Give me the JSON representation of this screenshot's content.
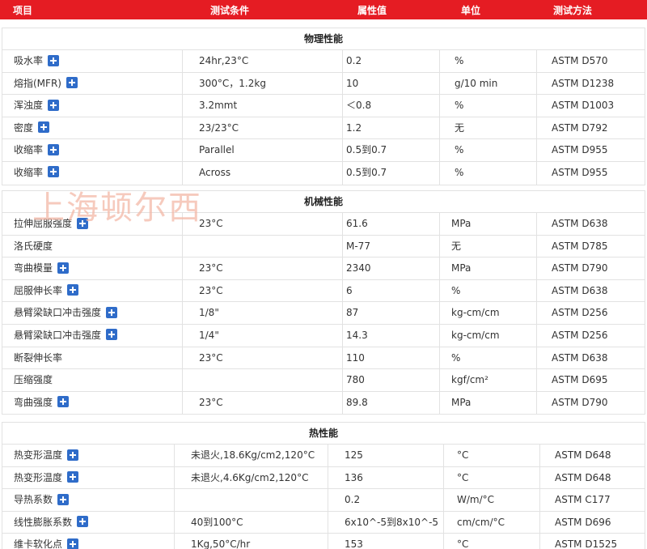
{
  "header": {
    "item": "项目",
    "condition": "测试条件",
    "value": "属性值",
    "unit": "单位",
    "method": "测试方法"
  },
  "watermark": "上海顿尔西",
  "sections": [
    {
      "title": "物理性能",
      "rows": [
        {
          "name": "吸水率",
          "info": true,
          "condition": "24hr,23°C",
          "value": "0.2",
          "unit": "%",
          "method": "ASTM D570"
        },
        {
          "name": "熔指(MFR)",
          "info": true,
          "condition": "300°C，1.2kg",
          "value": "10",
          "unit": "g/10 min",
          "method": "ASTM D1238"
        },
        {
          "name": "浑浊度",
          "info": true,
          "condition": "3.2mmt",
          "value": "＜0.8",
          "unit": "%",
          "method": "ASTM D1003"
        },
        {
          "name": "密度",
          "info": true,
          "condition": "23/23°C",
          "value": "1.2",
          "unit": "无",
          "method": "ASTM D792"
        },
        {
          "name": "收缩率",
          "info": true,
          "condition": "Parallel",
          "value": "0.5到0.7",
          "unit": "%",
          "method": "ASTM D955"
        },
        {
          "name": "收缩率",
          "info": true,
          "condition": "Across",
          "value": "0.5到0.7",
          "unit": "%",
          "method": "ASTM D955"
        }
      ]
    },
    {
      "title": "机械性能",
      "rows": [
        {
          "name": "拉伸屈服强度",
          "info": true,
          "condition": "23°C",
          "value": "61.6",
          "unit": "MPa",
          "method": "ASTM D638"
        },
        {
          "name": "洛氏硬度",
          "info": false,
          "condition": "",
          "value": "M-77",
          "unit": "无",
          "method": "ASTM D785"
        },
        {
          "name": "弯曲模量",
          "info": true,
          "condition": "23°C",
          "value": "2340",
          "unit": "MPa",
          "method": "ASTM D790"
        },
        {
          "name": "屈服伸长率",
          "info": true,
          "condition": "23°C",
          "value": "6",
          "unit": "%",
          "method": "ASTM D638"
        },
        {
          "name": "悬臂梁缺口冲击强度",
          "info": true,
          "condition": "1/8\"",
          "value": "87",
          "unit": "kg-cm/cm",
          "method": "ASTM D256"
        },
        {
          "name": "悬臂梁缺口冲击强度",
          "info": true,
          "condition": "1/4\"",
          "value": "14.3",
          "unit": "kg-cm/cm",
          "method": "ASTM D256"
        },
        {
          "name": "断裂伸长率",
          "info": false,
          "condition": "23°C",
          "value": "110",
          "unit": "%",
          "method": "ASTM D638"
        },
        {
          "name": "压缩强度",
          "info": false,
          "condition": "",
          "value": "780",
          "unit": "kgf/cm²",
          "method": "ASTM D695"
        },
        {
          "name": "弯曲强度",
          "info": true,
          "condition": "23°C",
          "value": "89.8",
          "unit": "MPa",
          "method": "ASTM D790"
        }
      ]
    },
    {
      "title": "热性能",
      "rows": [
        {
          "name": "热变形温度",
          "info": true,
          "condition": "未退火,18.6Kg/cm2,120°C",
          "value": "125",
          "unit": "°C",
          "method": "ASTM D648"
        },
        {
          "name": "热变形温度",
          "info": true,
          "condition": "未退火,4.6Kg/cm2,120°C",
          "value": "136",
          "unit": "°C",
          "method": "ASTM D648"
        },
        {
          "name": "导热系数",
          "info": true,
          "condition": "",
          "value": "0.2",
          "unit": "W/m/°C",
          "method": "ASTM C177"
        },
        {
          "name": "线性膨胀系数",
          "info": true,
          "condition": "40到100°C",
          "value": "6x10^-5到8x10^-5",
          "unit": "cm/cm/°C",
          "method": "ASTM D696"
        },
        {
          "name": "维卡软化点",
          "info": true,
          "condition": "1Kg,50°C/hr",
          "value": "153",
          "unit": "°C",
          "method": "ASTM D1525"
        }
      ]
    }
  ]
}
